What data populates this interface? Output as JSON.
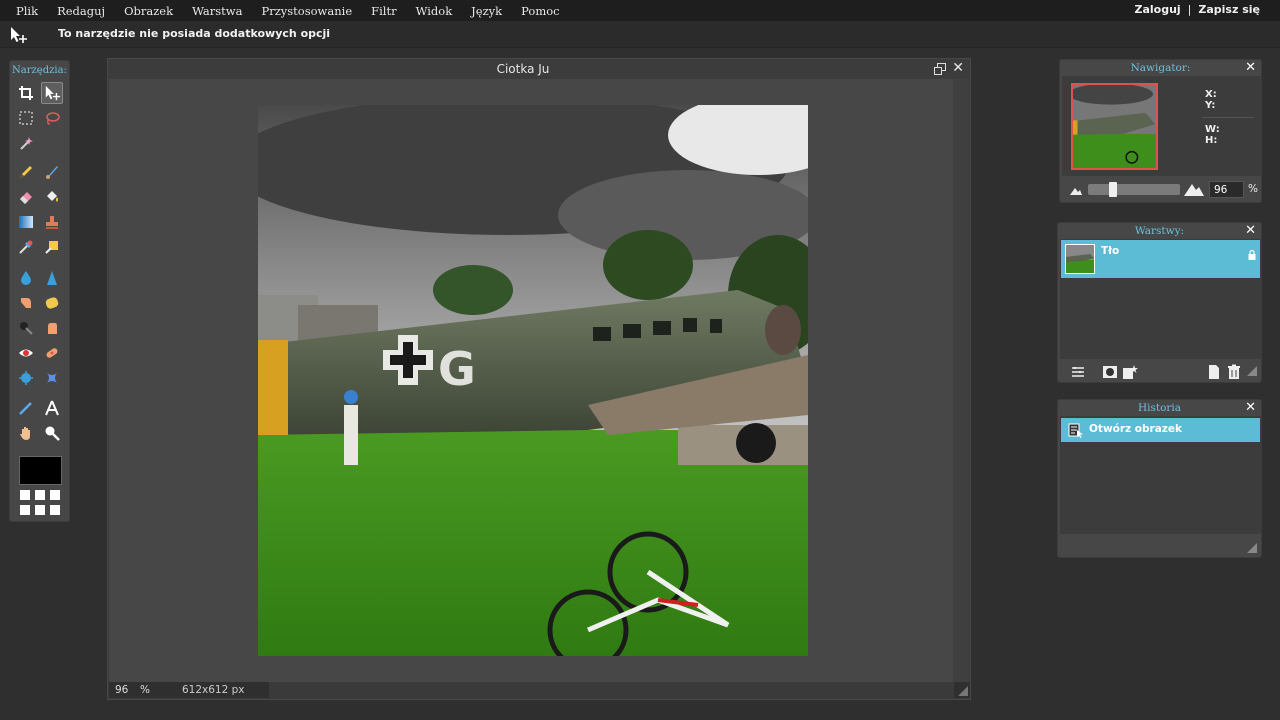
{
  "menu": {
    "items": [
      "Plik",
      "Redaguj",
      "Obrazek",
      "Warstwa",
      "Przystosowanie",
      "Filtr",
      "Widok",
      "Język",
      "Pomoc"
    ],
    "login": "Zaloguj",
    "separator": "|",
    "signup": "Zapisz się"
  },
  "options": {
    "message": "To narzędzie nie posiada dodatkowych opcji"
  },
  "tools": {
    "title": "Narzędzia:",
    "active_tool": "move-tool",
    "foreground_color": "#000000"
  },
  "document": {
    "title": "Ciotka Ju",
    "zoom": "96",
    "zoom_unit": "%",
    "size": "612x612 px"
  },
  "navigator": {
    "title": "Nawigator:",
    "x_label": "X:",
    "y_label": "Y:",
    "w_label": "W:",
    "h_label": "H:",
    "zoom": "96",
    "zoom_unit": "%",
    "zoom_fraction": 0.25
  },
  "layers": {
    "title": "Warstwy:",
    "items": [
      {
        "name": "Tło",
        "locked": true
      }
    ]
  },
  "history": {
    "title": "Historia",
    "items": [
      {
        "label": "Otwórz obrazek"
      }
    ]
  },
  "colors": {
    "accent": "#5cbcd6",
    "panel_title": "#6fc0dc",
    "thumb_border": "#e05050"
  }
}
